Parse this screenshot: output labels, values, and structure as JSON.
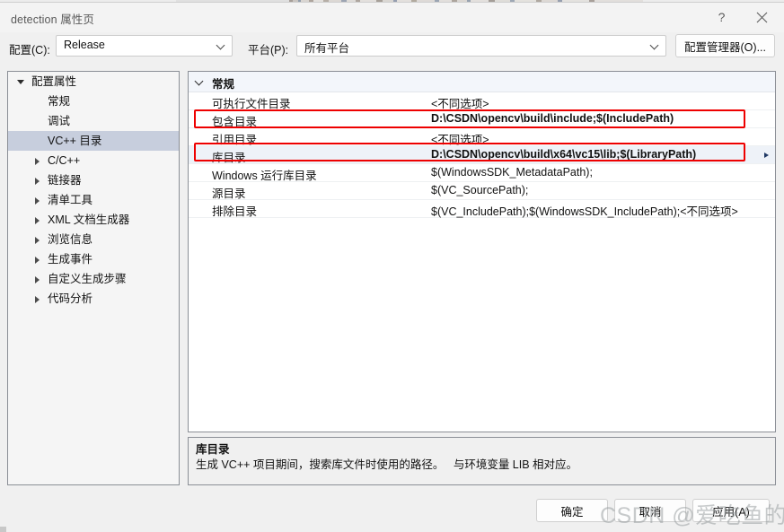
{
  "window": {
    "title": "detection 属性页",
    "help_icon": "help-question-icon",
    "help_glyph": "?",
    "close_icon": "close-x-icon"
  },
  "toolbar": {
    "config_label": "配置(C):",
    "config_value": "Release",
    "platform_label": "平台(P):",
    "platform_value": "所有平台",
    "config_manager_label": "配置管理器(O)..."
  },
  "tree": {
    "items": [
      {
        "label": "配置属性",
        "depth": 0,
        "twisty": "expanded",
        "selected": false
      },
      {
        "label": "常规",
        "depth": 1,
        "twisty": "none",
        "selected": false
      },
      {
        "label": "调试",
        "depth": 1,
        "twisty": "none",
        "selected": false
      },
      {
        "label": "VC++ 目录",
        "depth": 1,
        "twisty": "none",
        "selected": true
      },
      {
        "label": "C/C++",
        "depth": 1,
        "twisty": "collapsed",
        "selected": false
      },
      {
        "label": "链接器",
        "depth": 1,
        "twisty": "collapsed",
        "selected": false
      },
      {
        "label": "清单工具",
        "depth": 1,
        "twisty": "collapsed",
        "selected": false
      },
      {
        "label": "XML 文档生成器",
        "depth": 1,
        "twisty": "collapsed",
        "selected": false
      },
      {
        "label": "浏览信息",
        "depth": 1,
        "twisty": "collapsed",
        "selected": false
      },
      {
        "label": "生成事件",
        "depth": 1,
        "twisty": "collapsed",
        "selected": false
      },
      {
        "label": "自定义生成步骤",
        "depth": 1,
        "twisty": "collapsed",
        "selected": false
      },
      {
        "label": "代码分析",
        "depth": 1,
        "twisty": "collapsed",
        "selected": false
      }
    ]
  },
  "grid": {
    "group_label": "常规",
    "group_chevron_icon": "chevron-down-icon",
    "rows": [
      {
        "name": "可执行文件目录",
        "value": "<不同选项>",
        "bold": false,
        "selected": false,
        "highlighted": false
      },
      {
        "name": "包含目录",
        "value": "D:\\CSDN\\opencv\\build\\include;$(IncludePath)",
        "bold": true,
        "selected": false,
        "highlighted": true
      },
      {
        "name": "引用目录",
        "value": "<不同选项>",
        "bold": false,
        "selected": false,
        "highlighted": false
      },
      {
        "name": "库目录",
        "value": "D:\\CSDN\\opencv\\build\\x64\\vc15\\lib;$(LibraryPath)",
        "bold": true,
        "selected": true,
        "highlighted": true
      },
      {
        "name": "Windows 运行库目录",
        "value": "$(WindowsSDK_MetadataPath);",
        "bold": false,
        "selected": false,
        "highlighted": false
      },
      {
        "name": "源目录",
        "value": "$(VC_SourcePath);",
        "bold": false,
        "selected": false,
        "highlighted": false
      },
      {
        "name": "排除目录",
        "value": "$(VC_IncludePath);$(WindowsSDK_IncludePath);<不同选项>",
        "bold": false,
        "selected": false,
        "highlighted": false
      }
    ],
    "annotation_color": "#ee0000",
    "selection_color": "#eef2f8",
    "tree_selection_color": "#c7cedd"
  },
  "description": {
    "title": "库目录",
    "body": "生成 VC++ 项目期间，搜索库文件时使用的路径。   与环境变量 LIB 相对应。"
  },
  "buttons": {
    "ok": "确定",
    "cancel": "取消",
    "apply": "应用(A)"
  },
  "watermark": {
    "text": "CSDN @爱吃鱼的小熊"
  }
}
